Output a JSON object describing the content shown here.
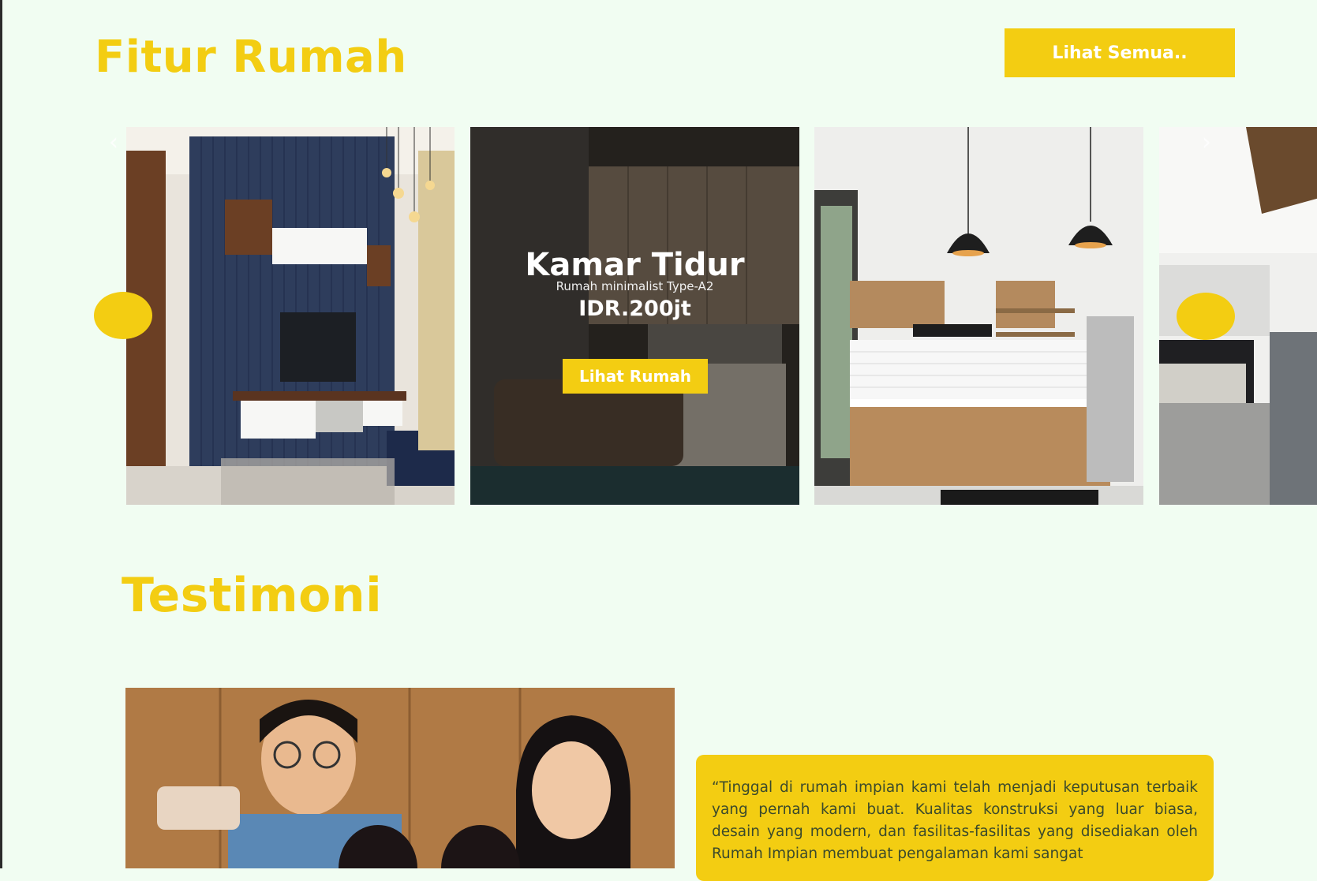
{
  "features": {
    "title": "Fitur Rumah",
    "see_all_label": "Lihat Semua.."
  },
  "carousel": {
    "cards": [
      {
        "image": "living-room-tv-wall"
      },
      {
        "image": "bedroom",
        "title": "Kamar Tidur",
        "subtitle": "Rumah minimalist Type-A2",
        "price": "IDR.200jt",
        "button_label": "Lihat Rumah"
      },
      {
        "image": "kitchen"
      },
      {
        "image": "open-living-area"
      }
    ],
    "prev_icon": "chevron-left-icon",
    "next_icon": "chevron-right-icon"
  },
  "testimonials": {
    "title": "Testimoni",
    "photo": "family-selfie",
    "quote": "“Tinggal di rumah impian kami telah menjadi keputusan terbaik yang pernah kami buat. Kualitas konstruksi yang luar biasa, desain yang modern, dan fasilitas-fasilitas yang disediakan oleh Rumah Impian membuat pengalaman kami sangat"
  },
  "colors": {
    "accent": "#f3cd12",
    "background": "#f1fdf2",
    "quote_text": "#3b4a2c"
  }
}
